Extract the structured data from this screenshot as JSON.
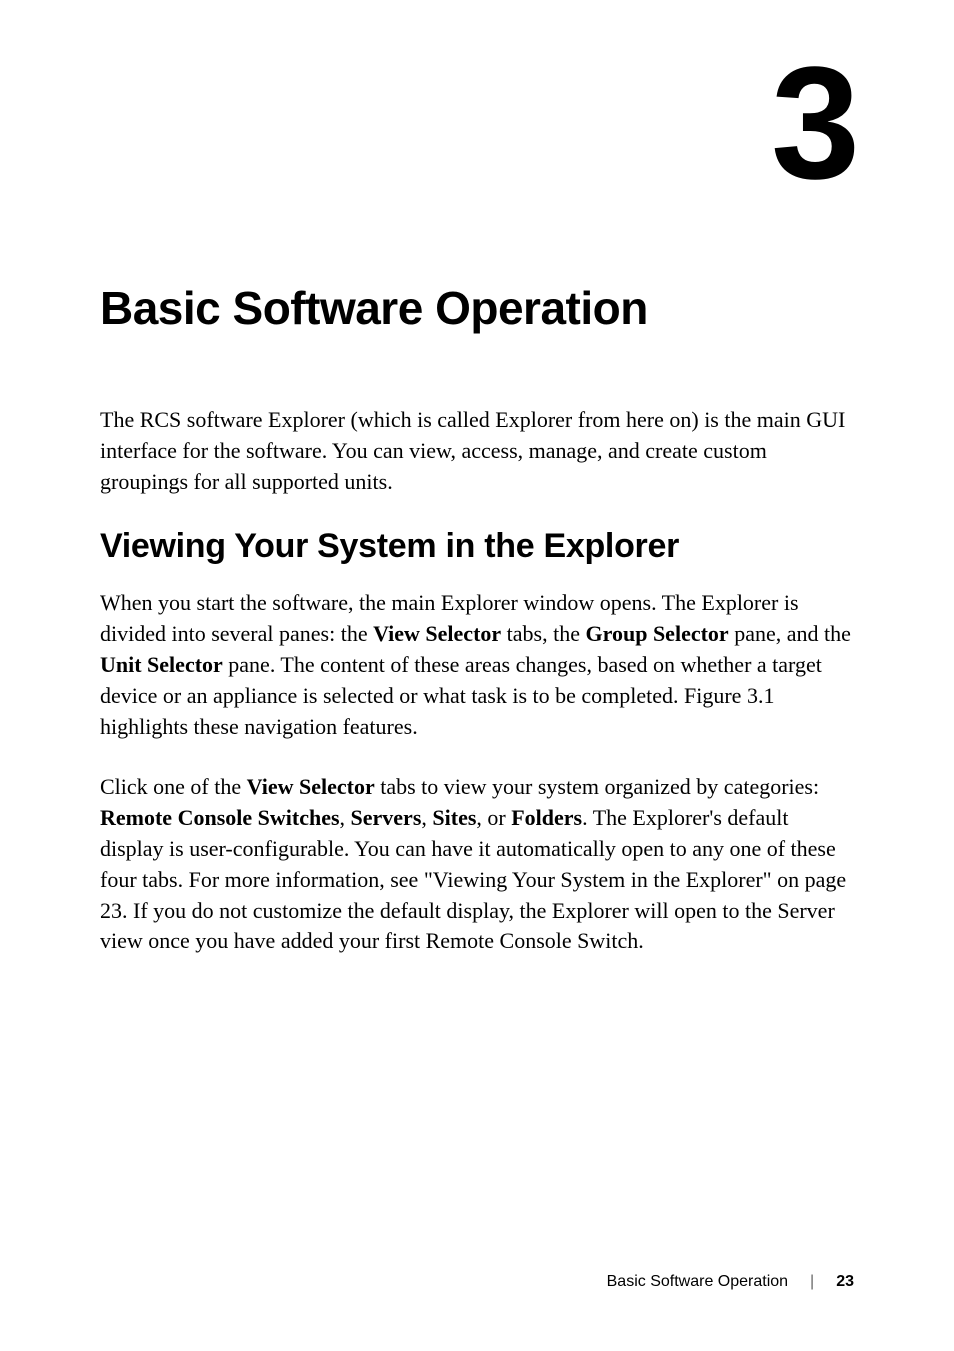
{
  "chapter": {
    "number": "3",
    "title": "Basic Software Operation"
  },
  "intro": {
    "text": "The RCS software Explorer (which is called Explorer from here on) is the main GUI interface for the software. You can view, access, manage, and create custom groupings for all supported units."
  },
  "section": {
    "heading": "Viewing Your System in the Explorer",
    "para1_a": "When you start the software, the main Explorer window opens. The Explorer is divided into several panes: the ",
    "para1_b": "View Selector",
    "para1_c": " tabs, the ",
    "para1_d": "Group Selector",
    "para1_e": " pane, and the ",
    "para1_f": "Unit Selector",
    "para1_g": " pane. The content of these areas changes, based on whether a target device or an appliance is selected or what task is to be completed. Figure 3.1 highlights these navigation features.",
    "para2_a": "Click one of the ",
    "para2_b": "View Selector",
    "para2_c": " tabs to view your system organized by categories: ",
    "para2_d": "Remote Console Switches",
    "para2_e": ", ",
    "para2_f": "Servers",
    "para2_g": ", ",
    "para2_h": "Sites",
    "para2_i": ", or ",
    "para2_j": "Folders",
    "para2_k": ". The Explorer's default display is user-configurable. You can have it automatically open to any one of these four tabs. For more information, see \"Viewing Your System in the Explorer\" on page 23. If you do not customize the default display, the Explorer will open to the Server view once you have added your first Remote Console Switch."
  },
  "footer": {
    "title": "Basic Software Operation",
    "divider": "|",
    "page": "23"
  }
}
